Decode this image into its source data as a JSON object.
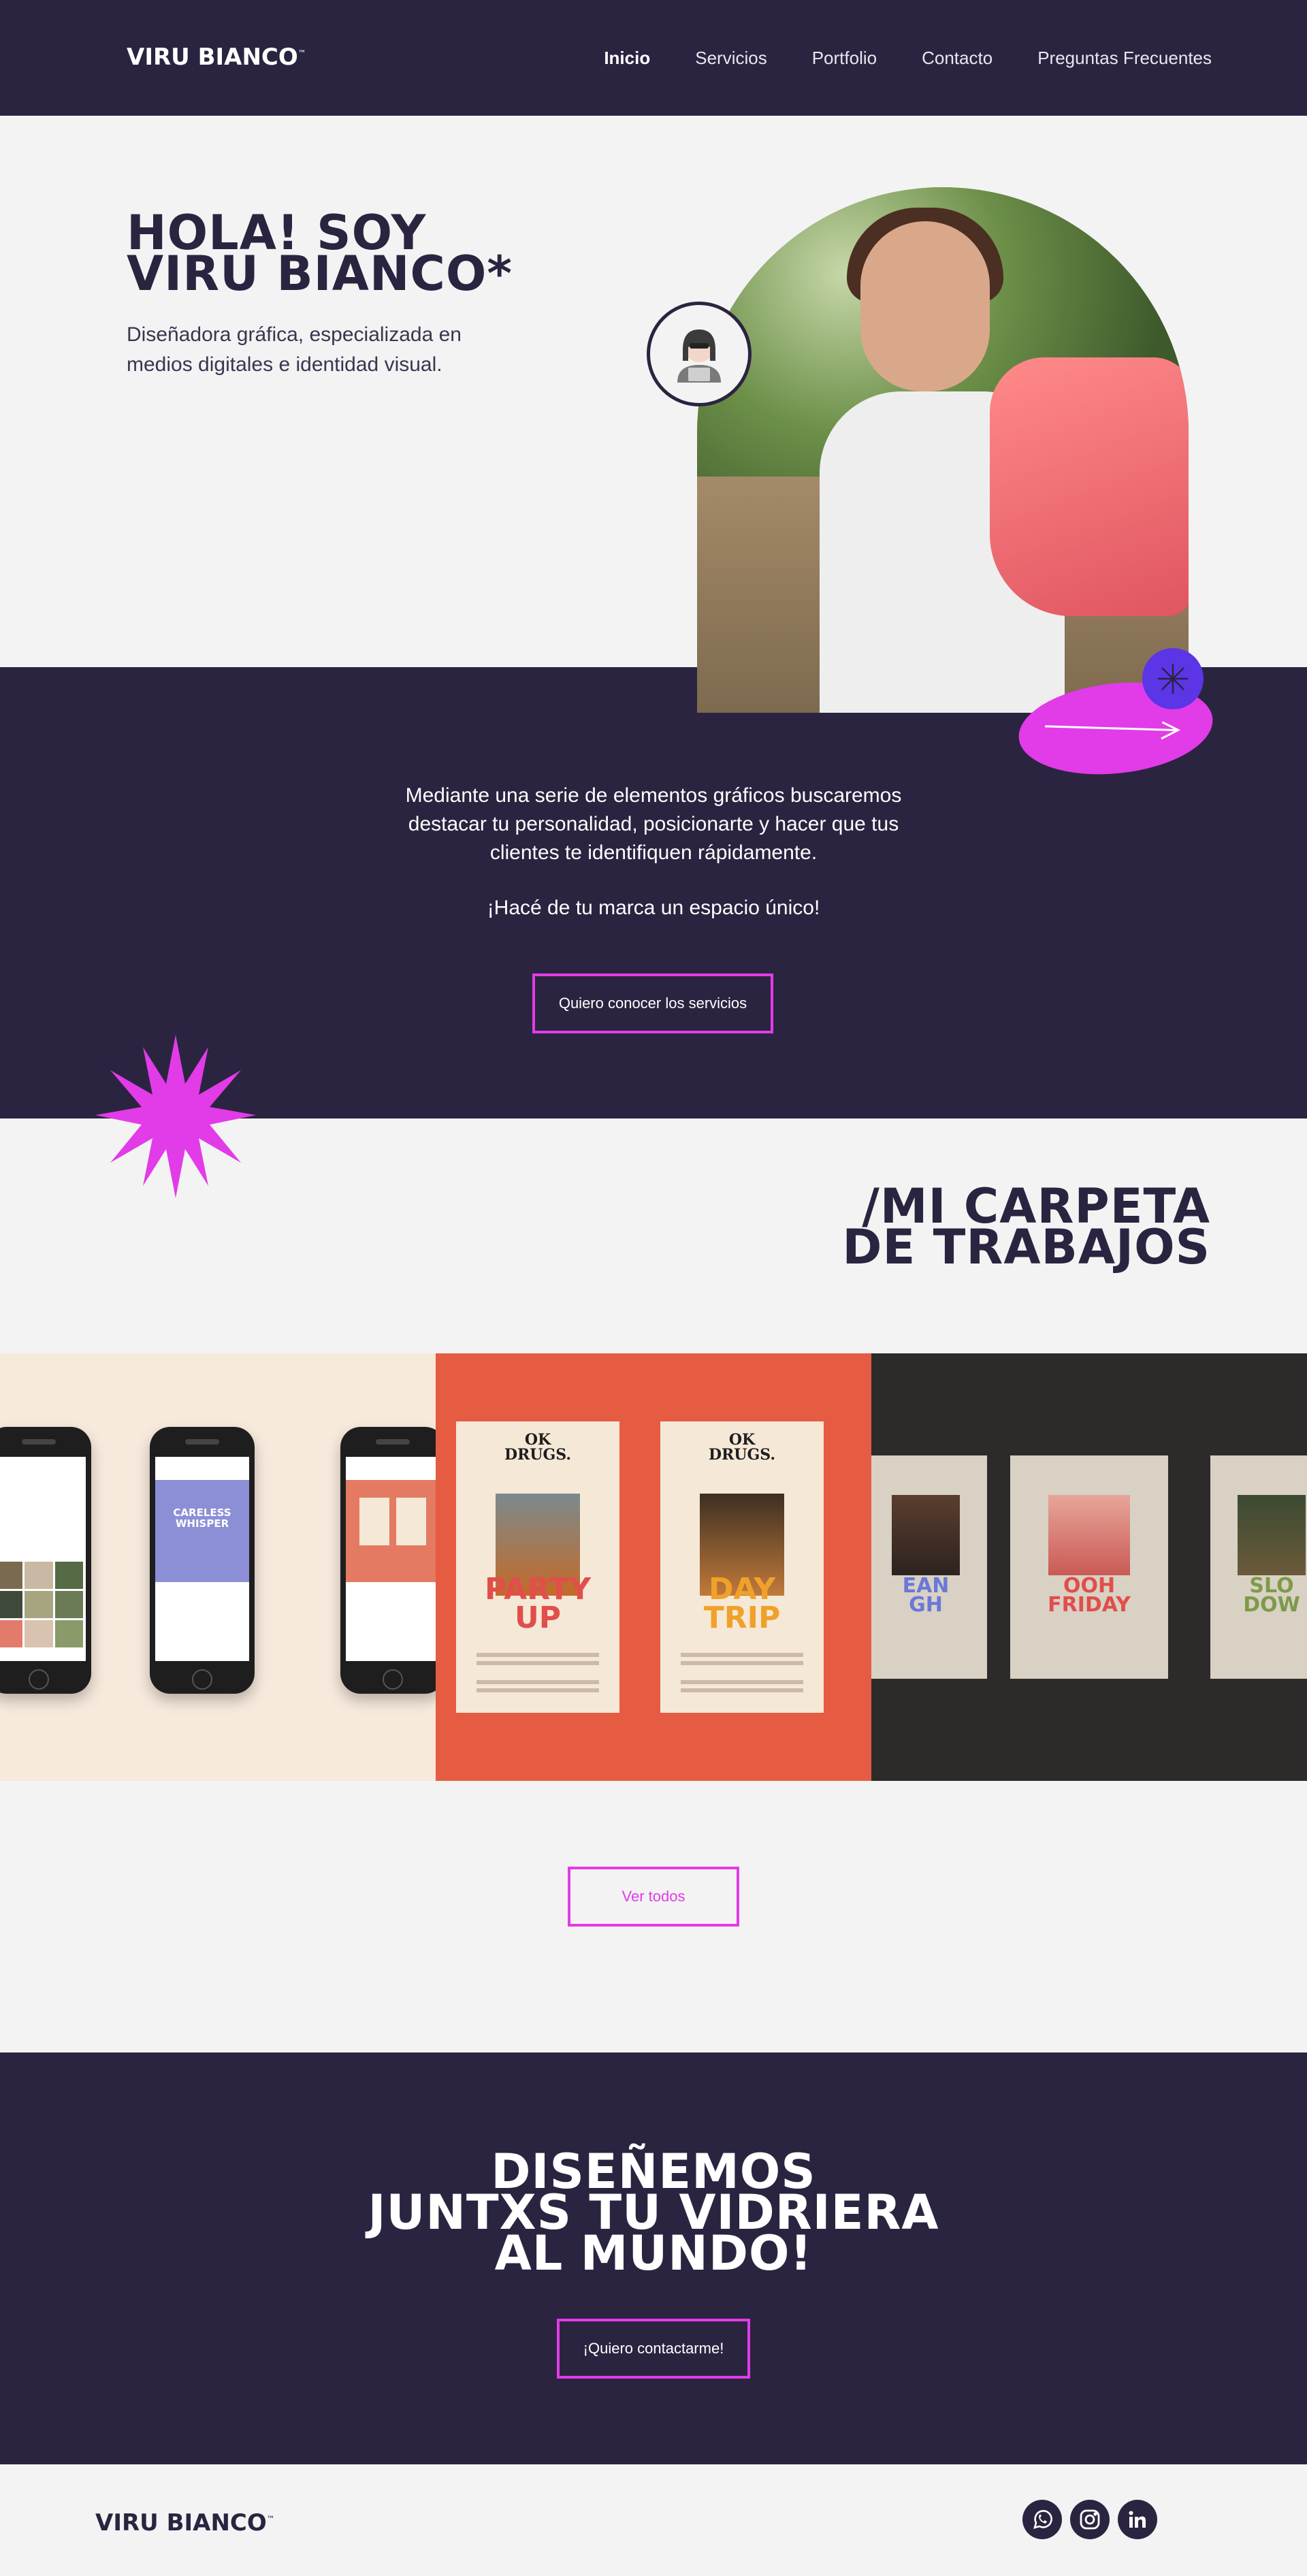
{
  "nav": {
    "logo": "VIRU BIANCO",
    "logo_mark": "™",
    "links": [
      "Inicio",
      "Servicios",
      "Portfolio",
      "Contacto",
      "Preguntas Frecuentes"
    ]
  },
  "hero": {
    "title_line1": "HOLA! SOY",
    "title_line2": "VIRU BIANCO*",
    "subtitle": "Diseñadora gráfica, especializada en medios digitales e identidad visual."
  },
  "intro": {
    "paragraph": "Mediante una serie de elementos gráficos buscaremos destacar tu personalidad, posicionarte y hacer que tus clientes te identifiquen rápidamente.",
    "tagline": "¡Hacé de tu marca un espacio único!",
    "button": "Quiero conocer los servicios"
  },
  "portfolio": {
    "title_line1": "/MI CARPETA",
    "title_line2": "DE TRABAJOS",
    "posters": [
      {
        "brand_line1": "OK",
        "brand_line2": "DRUGS.",
        "headline_line1": "PARTY",
        "headline_line2": "UP"
      },
      {
        "brand_line1": "OK",
        "brand_line2": "DRUGS.",
        "headline_line1": "DAY",
        "headline_line2": "TRIP"
      }
    ],
    "minis": [
      {
        "line1": "EAN",
        "line2": "GH"
      },
      {
        "line1": "OOH",
        "line2": "FRIDAY"
      },
      {
        "line1": "SLO",
        "line2": "DOW"
      }
    ],
    "phone_text": "CARELESS WHISPER",
    "button": "Ver todos"
  },
  "cta": {
    "title_line1": "DISEÑEMOS",
    "title_line2": "JUNTXS TU VIDRIERA",
    "title_line3": "AL MUNDO!",
    "button": "¡Quiero contactarme!"
  },
  "footer": {
    "logo": "VIRU BIANCO",
    "logo_mark": "™",
    "socials": [
      "whatsapp-icon",
      "instagram-icon",
      "linkedin-icon"
    ]
  },
  "colors": {
    "navy": "#2b2440",
    "magenta": "#e23be8",
    "violet": "#5b35e6",
    "light": "#f3f3f3"
  }
}
